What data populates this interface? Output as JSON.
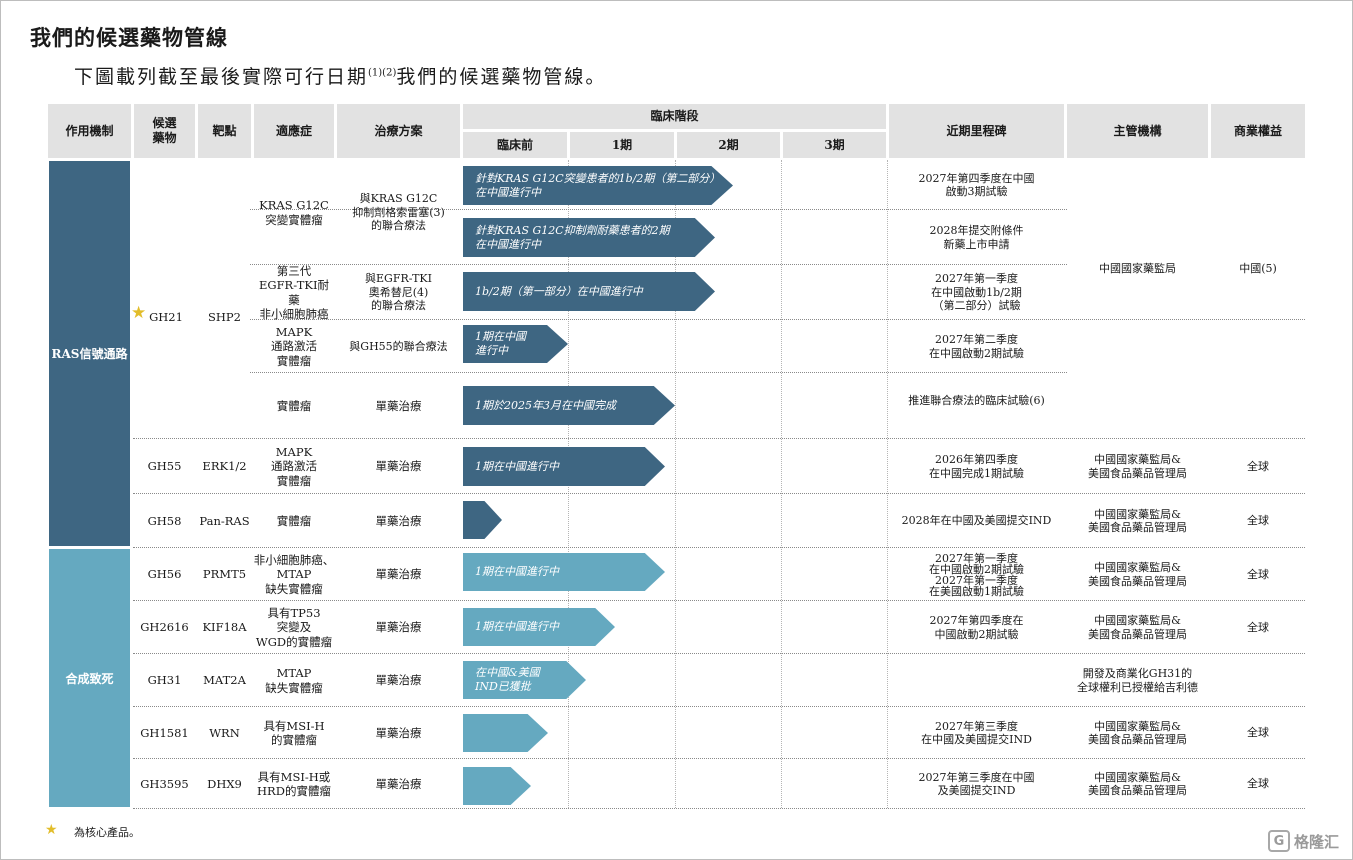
{
  "title": "我們的候選藥物管線",
  "subtitle": {
    "text": "下圖載列截至最後實際可行日期",
    "sup": "(1)(2)",
    "text2": "我們的候選藥物管線。"
  },
  "headers": {
    "mechanism": "作用機制",
    "candidate": "候選\n藥物",
    "target": "靶點",
    "indication": "適應症",
    "regimen": "治療方案",
    "phase_group": "臨床階段",
    "phases": [
      "臨床前",
      "1期",
      "2期",
      "3期"
    ],
    "milestone": "近期里程碑",
    "regulator": "主管機構",
    "rights": "商業權益"
  },
  "mechanisms": [
    "RAS信號通路",
    "合成致死"
  ],
  "rows": [
    {
      "candidate": "GH21",
      "target": "SHP2",
      "core": true
    },
    {
      "candidate": "GH55",
      "target": "ERK1/2",
      "indication": "MAPK\n通路激活\n實體瘤",
      "regimen": "單藥治療",
      "arrow": "1期在中國進行中",
      "milestone": "2026年第四季度\n在中國完成1期試驗",
      "regulator": "中國國家藥監局&\n美國食品藥品管理局",
      "rights": "全球"
    },
    {
      "candidate": "GH58",
      "target": "Pan-RAS",
      "indication": "實體瘤",
      "regimen": "單藥治療",
      "arrow": "",
      "milestone": "2028年在中國及美國提交IND",
      "regulator": "中國國家藥監局&\n美國食品藥品管理局",
      "rights": "全球"
    },
    {
      "candidate": "GH56",
      "target": "PRMT5",
      "indication": "非小細胞肺癌、\nMTAP\n缺失實體瘤",
      "regimen": "單藥治療",
      "arrow": "1期在中國進行中",
      "milestone": "2027年第一季度\n在中國啟動2期試驗\n2027年第一季度\n在美國啟動1期試驗",
      "regulator": "中國國家藥監局&\n美國食品藥品管理局",
      "rights": "全球"
    },
    {
      "candidate": "GH2616",
      "target": "KIF18A",
      "indication": "具有TP53\n突變及\nWGD的實體瘤",
      "regimen": "單藥治療",
      "arrow": "1期在中國進行中",
      "milestone": "2027年第四季度在\n中國啟動2期試驗",
      "regulator": "中國國家藥監局&\n美國食品藥品管理局",
      "rights": "全球"
    },
    {
      "candidate": "GH31",
      "target": "MAT2A",
      "indication": "MTAP\n缺失實體瘤",
      "regimen": "單藥治療",
      "arrow": "在中國&美國\nIND已獲批",
      "milestone": "",
      "regulator": "",
      "rights": ""
    },
    {
      "candidate": "GH1581",
      "target": "WRN",
      "indication": "具有MSI-H\n的實體瘤",
      "regimen": "單藥治療",
      "arrow": "",
      "milestone": "2027年第三季度\n在中國及美國提交IND",
      "regulator": "中國國家藥監局&\n美國食品藥品管理局",
      "rights": "全球"
    },
    {
      "candidate": "GH3595",
      "target": "DHX9",
      "indication": "具有MSI-H或\nHRD的實體瘤",
      "regimen": "單藥治療",
      "arrow": "",
      "milestone": "2027年第三季度在中國\n及美國提交IND",
      "regulator": "中國國家藥監局&\n美國食品藥品管理局",
      "rights": "全球"
    }
  ],
  "gh21_sub": [
    {
      "indication": "KRAS G12C\n突變實體瘤",
      "regimen": "與KRAS G12C\n抑制劑格索雷塞(3)\n的聯合療法",
      "arrow": "針對KRAS G12C突變患者的1b/2期（第二部分）\n在中國進行中",
      "milestone": "2027年第四季度在中國\n啟動3期試驗"
    },
    {
      "indication": "",
      "regimen": "",
      "arrow": "針對KRAS G12C抑制劑耐藥患者的2期\n在中國進行中",
      "milestone": "2028年提交附條件\n新藥上市申請"
    },
    {
      "indication": "第三代\nEGFR-TKI耐藥\n非小細胞肺癌",
      "regimen": "與EGFR-TKI\n奧希替尼(4)\n的聯合療法",
      "arrow": "1b/2期（第一部分）在中國進行中",
      "milestone": "2027年第一季度\n在中國啟動1b/2期\n（第二部分）試驗"
    },
    {
      "indication": "MAPK\n通路激活\n實體瘤",
      "regimen": "與GH55的聯合療法",
      "arrow": "1期在中國\n進行中",
      "milestone": "2027年第二季度\n在中國啟動2期試驗"
    },
    {
      "indication": "實體瘤",
      "regimen": "單藥治療",
      "arrow": "1期於2025年3月在中國完成",
      "milestone": "推進聯合療法的臨床試驗(6)"
    }
  ],
  "gh21_regulator": "中國國家藥監局",
  "gh21_rights": "中國(5)",
  "gh31_note": "開發及商業化GH31的\n全球權利已授權給吉利德",
  "legend": "為核心產品。",
  "watermark": "格隆汇",
  "colors": {
    "ras": "#3e6682",
    "synthetic_lethal": "#65a9c0",
    "header_bg": "#e2e2e2",
    "star": "#e2bd2a"
  }
}
